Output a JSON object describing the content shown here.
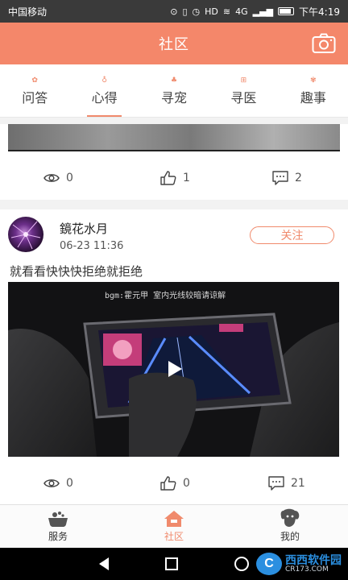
{
  "status_bar": {
    "carrier": "中国移动",
    "network": "4G",
    "time": "下午4:19",
    "icons": [
      "location-icon",
      "vibrate-icon",
      "alarm-icon",
      "hd-icon",
      "wifi-icon",
      "signal-icon",
      "battery-icon"
    ]
  },
  "header": {
    "title": "社区",
    "action_icon": "camera-icon",
    "bg_color": "#f4876a"
  },
  "tabs": [
    {
      "label": "问答",
      "icon": "qa-icon",
      "active": false
    },
    {
      "label": "心得",
      "icon": "bulb-icon",
      "active": true
    },
    {
      "label": "寻宠",
      "icon": "pet-icon",
      "active": false
    },
    {
      "label": "寻医",
      "icon": "medical-icon",
      "active": false
    },
    {
      "label": "趣事",
      "icon": "fun-icon",
      "active": false
    }
  ],
  "prev_post": {
    "views": "0",
    "likes": "1",
    "comments": "2"
  },
  "post": {
    "author": "鏡花水月",
    "time": "06-23 11:36",
    "follow_label": "关注",
    "text": "就看看快快快拒绝就拒绝",
    "video_caption": "bgm:霍元甲   室内光线较暗请谅解",
    "views": "0",
    "likes": "0",
    "comments": "21"
  },
  "bottom_nav": [
    {
      "label": "服务",
      "icon": "pet-bath-icon",
      "active": false
    },
    {
      "label": "社区",
      "icon": "home-icon",
      "active": true
    },
    {
      "label": "我的",
      "icon": "dog-head-icon",
      "active": false
    }
  ],
  "watermark": {
    "logo_text": "C",
    "name": "西西软件园",
    "domain": "CR173.COM"
  },
  "colors": {
    "accent": "#f08a6c",
    "status_bar": "#3a3a3a"
  }
}
